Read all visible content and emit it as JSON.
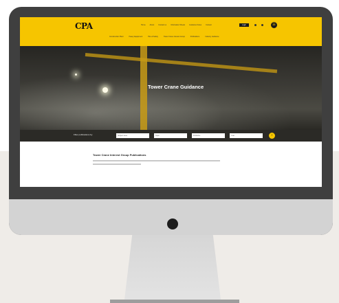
{
  "header": {
    "logo": "CPA",
    "top_links": [
      "Home",
      "About",
      "Contact us",
      "Information Sheets",
      "Guidance Notes",
      "Contact"
    ],
    "login_label": "Login",
    "menu_icon": "menu-icon",
    "sub_links": [
      "Construction Plant",
      "Heavy Equipment",
      "Hire & Safety",
      "Tower Crane Interest Group",
      "Publications",
      "Industry Guidance"
    ]
  },
  "hero": {
    "title": "Tower Crane Guidance"
  },
  "filter": {
    "label": "Filter publications by",
    "selects": [
      "Subject area",
      "Topic",
      "Publisher",
      "Year"
    ],
    "go_icon": "arrow-right-icon"
  },
  "content": {
    "heading": "Tower Crane Interest Group Publications"
  },
  "colors": {
    "brand_yellow": "#f6c500",
    "dark": "#2b2a26",
    "monitor_bezel": "#3f3f3f",
    "monitor_chin": "#d3d3d3"
  }
}
